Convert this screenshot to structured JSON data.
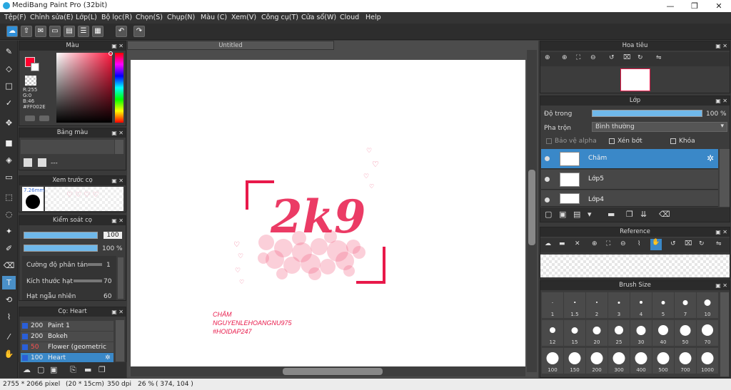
{
  "window": {
    "title": "MediBang Paint Pro (32bit)",
    "min": "—",
    "restore": "❐",
    "close": "✕"
  },
  "menu": [
    "Tệp(F)",
    "Chỉnh sửa(E)",
    "Lớp(L)",
    "Bộ lọc(R)",
    "Chọn(S)",
    "Chụp(N)",
    "Màu (C)",
    "Xem(V)",
    "Công cụ(T)",
    "Cửa sổ(W)",
    "Cloud",
    "Help"
  ],
  "color_panel": {
    "title": "Màu",
    "r": "R:255",
    "g": "G:0",
    "b": "B:46",
    "hex": "#FF002E"
  },
  "palette_panel": {
    "title": "Bảng màu",
    "dash": "---"
  },
  "preview_panel": {
    "title": "Xem trước cọ",
    "size": "7.26mm"
  },
  "brush_control": {
    "title": "Kiểm soát cọ",
    "size_value": "100",
    "opacity_value": "100 %",
    "params": [
      {
        "label": "Cường độ phân tán",
        "value": "1"
      },
      {
        "label": "Kích thước hạt",
        "value": "70"
      },
      {
        "label": "Hạt ngẫu nhiên",
        "value": "60"
      }
    ]
  },
  "brush_list": {
    "title": "Cọ: Heart",
    "items": [
      {
        "size": "200",
        "name": "Paint 1"
      },
      {
        "size": "200",
        "name": "Bokeh"
      },
      {
        "size": "50",
        "name": "Flower (geometric pat"
      },
      {
        "size": "100",
        "name": "Heart"
      }
    ]
  },
  "document": {
    "tab": "Untitled"
  },
  "artwork": {
    "big_text": "2k9",
    "line1": "CHĂM",
    "line2": "NGUYENLEHOANGNU975",
    "line3": "#HOIDAP247",
    "accent": "#e8194a"
  },
  "navigator": {
    "title": "Hoa tiêu"
  },
  "layers": {
    "title": "Lớp",
    "opacity_label": "Độ trong",
    "opacity_value": "100 %",
    "blend_label": "Pha trộn",
    "blend_value": "Bình thường",
    "alpha_label": "Bảo vệ alpha",
    "clip_label": "Xén bớt",
    "lock_label": "Khóa",
    "items": [
      {
        "name": "Chăm"
      },
      {
        "name": "Lớp5"
      },
      {
        "name": "Lớp4"
      }
    ]
  },
  "reference": {
    "title": "Reference"
  },
  "brush_size": {
    "title": "Brush Size",
    "sizes": [
      "1",
      "1.5",
      "2",
      "3",
      "4",
      "5",
      "7",
      "10",
      "12",
      "15",
      "20",
      "25",
      "30",
      "40",
      "50",
      "70",
      "100",
      "150",
      "200",
      "300",
      "400",
      "500",
      "700",
      "1000"
    ]
  },
  "status": {
    "dims": "2755 * 2066 pixel",
    "cm": "(20 * 15cm)",
    "dpi": "350 dpi",
    "zoom": "26 %",
    "coords": "( 374, 104 )"
  }
}
